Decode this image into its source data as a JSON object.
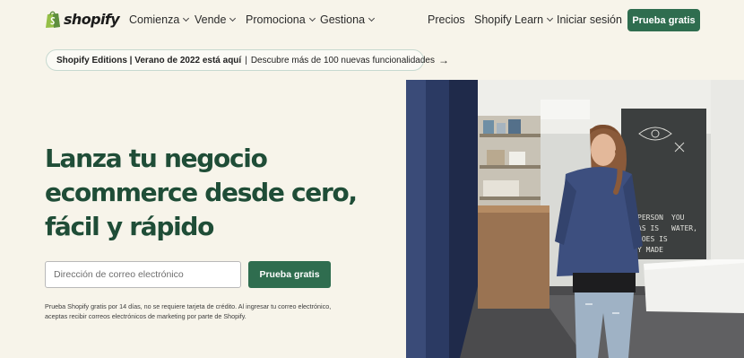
{
  "nav": {
    "logo_text": "shopify",
    "logo_icon": "shopping-bag-icon",
    "menus": [
      {
        "label": "Comienza"
      },
      {
        "label": "Vende"
      },
      {
        "label": "Promociona"
      },
      {
        "label": "Gestiona"
      }
    ],
    "links": {
      "pricing": "Precios",
      "learn": "Shopify Learn",
      "login": "Iniciar sesión"
    },
    "cta": "Prueba gratis"
  },
  "banner": {
    "bold_text": "Shopify Editions | Verano de 2022 está aquí",
    "separator": "|",
    "text": "Descubre más de 100 nuevas funcionalidades",
    "arrow": "→"
  },
  "hero": {
    "title_lines": [
      "Lanza tu negocio",
      "ecommerce desde cero,",
      "fácil y rápido"
    ],
    "email_placeholder": "Dirección de correo electrónico",
    "cta": "Prueba gratis",
    "disclaimer": "Prueba Shopify gratis por 14 días, no se requiere tarjeta de crédito. Al ingresar tu correo electrónico, aceptas recibir correos electrónicos de marketing por parte de Shopify."
  },
  "photo": {
    "board_lines": [
      "PERSON",
      "AS IS",
      "S",
      "JOES IS",
      "Y MADE"
    ],
    "board_line_2": "YOU",
    "board_line_3": "WATER,",
    "colors": {
      "brand_green": "#2f6d4f",
      "title_green": "#1f4d37",
      "background": "#f7f4ea"
    }
  }
}
